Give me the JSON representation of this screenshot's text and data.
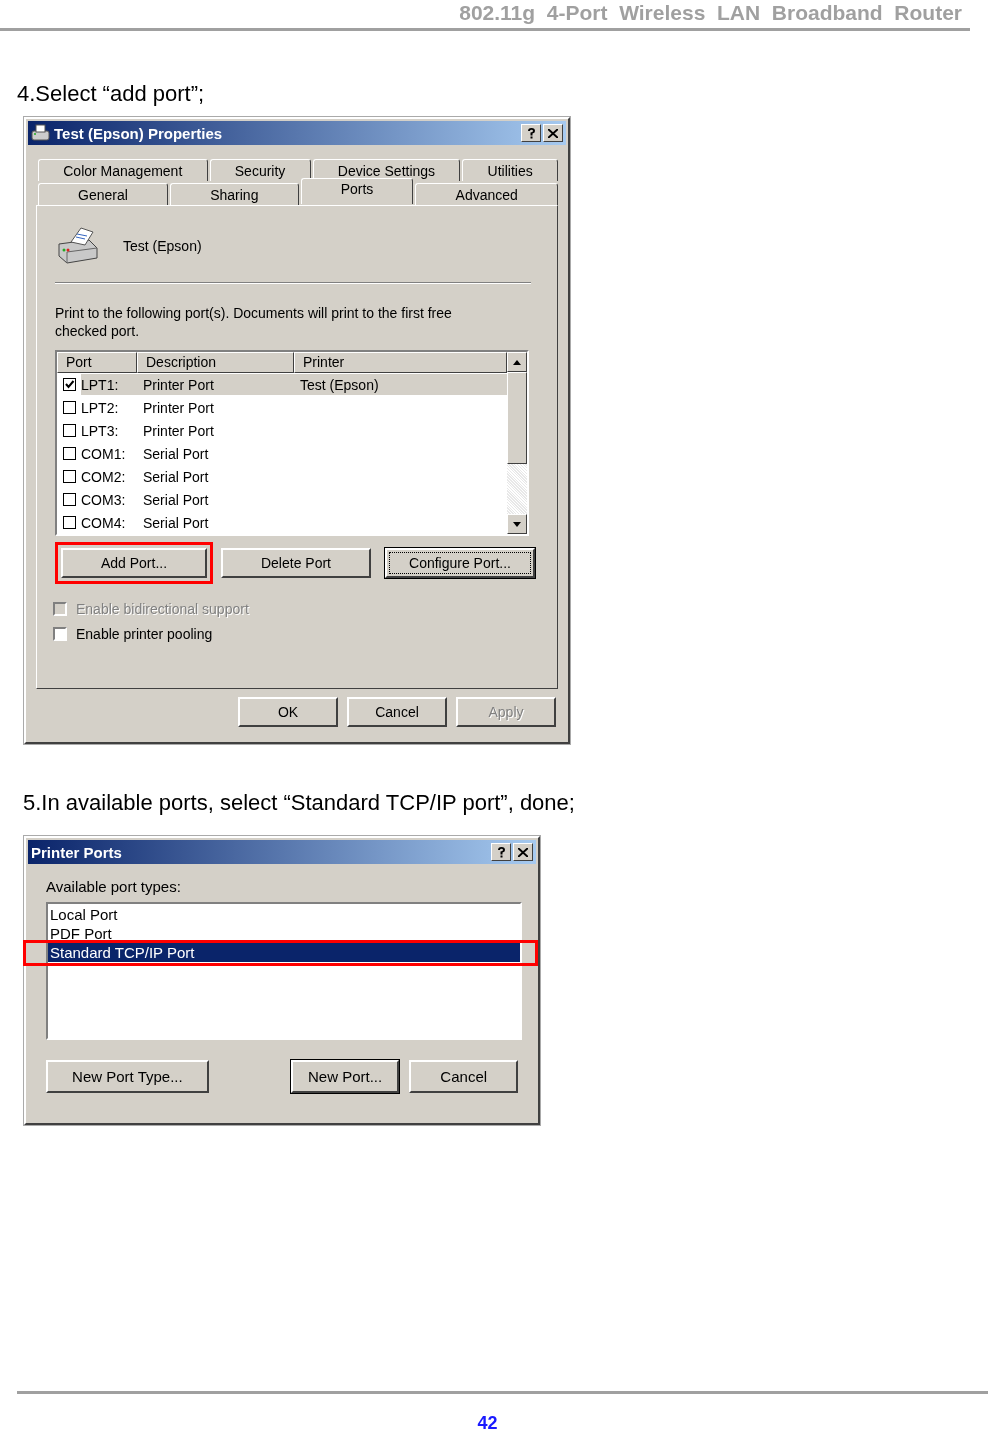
{
  "header": {
    "title": "802.11g  4-Port  Wireless  LAN  Broadband  Router"
  },
  "step_4": {
    "instruction": "4.Select “add port”;",
    "dialog": {
      "title": "Test (Epson) Properties",
      "tab_rows": [
        [
          {
            "label": "Color Management",
            "selected": false
          },
          {
            "label": "Security",
            "selected": false
          },
          {
            "label": "Device Settings",
            "selected": false
          },
          {
            "label": "Utilities",
            "selected": false
          }
        ],
        [
          {
            "label": "General",
            "selected": false
          },
          {
            "label": "Sharing",
            "selected": false
          },
          {
            "label": "Ports",
            "selected": true
          },
          {
            "label": "Advanced",
            "selected": false
          }
        ]
      ],
      "printer_name": "Test (Epson)",
      "description": "Print to the following port(s). Documents will print to the first free checked port.",
      "columns": [
        "Port",
        "Description",
        "Printer"
      ],
      "rows": [
        {
          "port": "LPT1:",
          "description": "Printer Port",
          "printer": "Test (Epson)",
          "checked": true,
          "selected": true
        },
        {
          "port": "LPT2:",
          "description": "Printer Port",
          "checked": false,
          "selected": false
        },
        {
          "port": "LPT3:",
          "description": "Printer Port",
          "checked": false,
          "selected": false
        },
        {
          "port": "COM1:",
          "description": "Serial Port",
          "checked": false,
          "selected": false
        },
        {
          "port": "COM2:",
          "description": "Serial Port",
          "checked": false,
          "selected": false
        },
        {
          "port": "COM3:",
          "description": "Serial Port",
          "checked": false,
          "selected": false
        },
        {
          "port": "COM4:",
          "description": "Serial Port",
          "checked": false,
          "selected": false
        }
      ],
      "port_buttons": [
        {
          "label": "Add Port...",
          "highlighted": true,
          "focused": false
        },
        {
          "label": "Delete Port",
          "highlighted": false,
          "focused": false
        },
        {
          "label": "Configure Port...",
          "highlighted": false,
          "focused": true
        }
      ],
      "options": [
        {
          "label": "Enable bidirectional support",
          "checked": false,
          "disabled": true
        },
        {
          "label": "Enable printer pooling",
          "checked": false,
          "disabled": false
        }
      ],
      "buttons": [
        {
          "label": "OK",
          "disabled": false
        },
        {
          "label": "Cancel",
          "disabled": false
        },
        {
          "label": "Apply",
          "disabled": true
        }
      ]
    }
  },
  "step_5": {
    "instruction": "5.In available ports, select “Standard TCP/IP port”, done;",
    "dialog": {
      "title": "Printer Ports",
      "list_label": "Available port types:",
      "items": [
        {
          "label": "Local Port",
          "selected": false,
          "highlighted": false
        },
        {
          "label": "PDF Port",
          "selected": false,
          "highlighted": false
        },
        {
          "label": "Standard TCP/IP Port",
          "selected": true,
          "highlighted": true
        }
      ],
      "buttons": [
        {
          "label": "New Port Type...",
          "default": false
        },
        {
          "label": "New Port...",
          "default": true
        },
        {
          "label": "Cancel",
          "default": false
        }
      ]
    }
  },
  "footer": {
    "page_number": "42"
  }
}
